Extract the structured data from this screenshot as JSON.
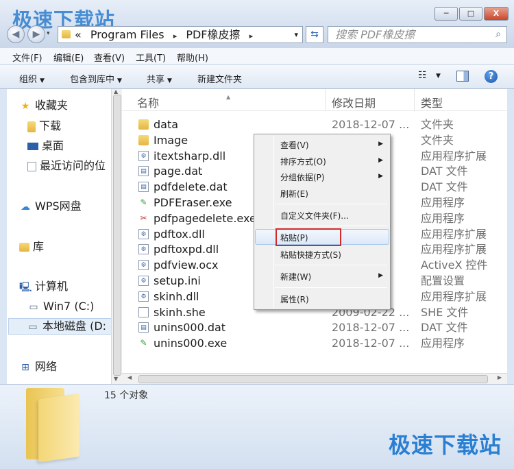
{
  "watermark": "极速下载站",
  "window": {
    "min": "─",
    "max": "□",
    "close": "X"
  },
  "address": {
    "prefix": "«",
    "segments": [
      "Program Files",
      "PDF橡皮擦"
    ],
    "sep": "▸",
    "dropdown": "▾"
  },
  "search": {
    "placeholder": "搜索 PDF橡皮擦"
  },
  "menu": [
    "文件(F)",
    "编辑(E)",
    "查看(V)",
    "工具(T)",
    "帮助(H)"
  ],
  "toolbar": {
    "organize": "组织",
    "include": "包含到库中",
    "share": "共享",
    "new_folder": "新建文件夹"
  },
  "nav": {
    "favorites": "收藏夹",
    "downloads": "下载",
    "desktop": "桌面",
    "recent": "最近访问的位",
    "wps": "WPS网盘",
    "library": "库",
    "computer": "计算机",
    "drive_c": "Win7 (C:)",
    "drive_d": "本地磁盘 (D:",
    "network": "网络"
  },
  "columns": {
    "name": "名称",
    "date": "修改日期",
    "type": "类型"
  },
  "files": [
    {
      "name": "data",
      "date": "2018-12-07 ...",
      "type": "文件夹",
      "icon": "folder"
    },
    {
      "name": "Image",
      "date": "...7 ...",
      "type": "文件夹",
      "icon": "folder"
    },
    {
      "name": "itextsharp.dll",
      "date": "...0 ...",
      "type": "应用程序扩展",
      "icon": "dll"
    },
    {
      "name": "page.dat",
      "date": "...4 ...",
      "type": "DAT 文件",
      "icon": "dat"
    },
    {
      "name": "pdfdelete.dat",
      "date": "...4 ...",
      "type": "DAT 文件",
      "icon": "dat"
    },
    {
      "name": "PDFEraser.exe",
      "date": "...1 ...",
      "type": "应用程序",
      "icon": "exe"
    },
    {
      "name": "pdfpagedelete.exe",
      "date": "...1 ...",
      "type": "应用程序",
      "icon": "scissors"
    },
    {
      "name": "pdftox.dll",
      "date": "...3 ...",
      "type": "应用程序扩展",
      "icon": "dll"
    },
    {
      "name": "pdftoxpd.dll",
      "date": "...3 ...",
      "type": "应用程序扩展",
      "icon": "dll"
    },
    {
      "name": "pdfview.ocx",
      "date": "...8 ...",
      "type": "ActiveX 控件",
      "icon": "dll"
    },
    {
      "name": "setup.ini",
      "date": "...1 ...",
      "type": "配置设置",
      "icon": "ini"
    },
    {
      "name": "skinh.dll",
      "date": "...5 ...",
      "type": "应用程序扩展",
      "icon": "dll"
    },
    {
      "name": "skinh.she",
      "date": "2009-02-22 ...",
      "type": "SHE 文件",
      "icon": "blank"
    },
    {
      "name": "unins000.dat",
      "date": "2018-12-07 ...",
      "type": "DAT 文件",
      "icon": "dat"
    },
    {
      "name": "unins000.exe",
      "date": "2018-12-07 ...",
      "type": "应用程序",
      "icon": "exe"
    }
  ],
  "context_menu": {
    "view": "查看(V)",
    "sort": "排序方式(O)",
    "group": "分组依据(P)",
    "refresh": "刷新(E)",
    "customize": "自定义文件夹(F)...",
    "paste": "粘贴(P)",
    "paste_shortcut": "粘贴快捷方式(S)",
    "new": "新建(W)",
    "properties": "属性(R)",
    "submenu_arrow": "▶"
  },
  "status": {
    "count": "15 个对象"
  },
  "colors": {
    "highlight_box": "#d12a2a",
    "watermark": "#2a7fd2"
  }
}
